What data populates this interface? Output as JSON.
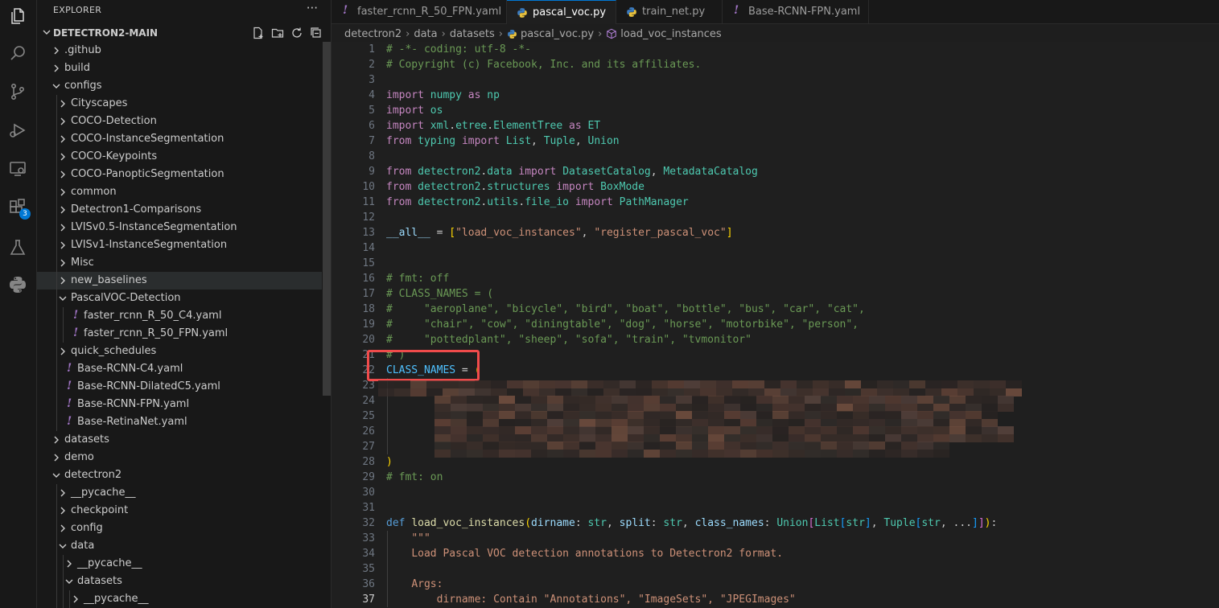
{
  "sidebar": {
    "title": "EXPLORER",
    "more": "···",
    "root": "DETECTRON2-MAIN",
    "rows": [
      {
        "label": ".github",
        "indent": 0,
        "kind": "folder",
        "open": false
      },
      {
        "label": "build",
        "indent": 0,
        "kind": "folder",
        "open": false
      },
      {
        "label": "configs",
        "indent": 0,
        "kind": "folder",
        "open": true
      },
      {
        "label": "Cityscapes",
        "indent": 1,
        "kind": "folder",
        "open": false
      },
      {
        "label": "COCO-Detection",
        "indent": 1,
        "kind": "folder",
        "open": false
      },
      {
        "label": "COCO-InstanceSegmentation",
        "indent": 1,
        "kind": "folder",
        "open": false
      },
      {
        "label": "COCO-Keypoints",
        "indent": 1,
        "kind": "folder",
        "open": false
      },
      {
        "label": "COCO-PanopticSegmentation",
        "indent": 1,
        "kind": "folder",
        "open": false
      },
      {
        "label": "common",
        "indent": 1,
        "kind": "folder",
        "open": false
      },
      {
        "label": "Detectron1-Comparisons",
        "indent": 1,
        "kind": "folder",
        "open": false
      },
      {
        "label": "LVISv0.5-InstanceSegmentation",
        "indent": 1,
        "kind": "folder",
        "open": false
      },
      {
        "label": "LVISv1-InstanceSegmentation",
        "indent": 1,
        "kind": "folder",
        "open": false
      },
      {
        "label": "Misc",
        "indent": 1,
        "kind": "folder",
        "open": false
      },
      {
        "label": "new_baselines",
        "indent": 1,
        "kind": "folder",
        "open": false,
        "selected": true
      },
      {
        "label": "PascalVOC-Detection",
        "indent": 1,
        "kind": "folder",
        "open": true
      },
      {
        "label": "faster_rcnn_R_50_C4.yaml",
        "indent": 2,
        "kind": "yaml"
      },
      {
        "label": "faster_rcnn_R_50_FPN.yaml",
        "indent": 2,
        "kind": "yaml"
      },
      {
        "label": "quick_schedules",
        "indent": 1,
        "kind": "folder",
        "open": false
      },
      {
        "label": "Base-RCNN-C4.yaml",
        "indent": 1,
        "kind": "yaml"
      },
      {
        "label": "Base-RCNN-DilatedC5.yaml",
        "indent": 1,
        "kind": "yaml"
      },
      {
        "label": "Base-RCNN-FPN.yaml",
        "indent": 1,
        "kind": "yaml"
      },
      {
        "label": "Base-RetinaNet.yaml",
        "indent": 1,
        "kind": "yaml"
      },
      {
        "label": "datasets",
        "indent": 0,
        "kind": "folder",
        "open": false
      },
      {
        "label": "demo",
        "indent": 0,
        "kind": "folder",
        "open": false
      },
      {
        "label": "detectron2",
        "indent": 0,
        "kind": "folder",
        "open": true
      },
      {
        "label": "__pycache__",
        "indent": 1,
        "kind": "folder",
        "open": false
      },
      {
        "label": "checkpoint",
        "indent": 1,
        "kind": "folder",
        "open": false
      },
      {
        "label": "config",
        "indent": 1,
        "kind": "folder",
        "open": false
      },
      {
        "label": "data",
        "indent": 1,
        "kind": "folder",
        "open": true
      },
      {
        "label": "__pycache__",
        "indent": 2,
        "kind": "folder",
        "open": false
      },
      {
        "label": "datasets",
        "indent": 2,
        "kind": "folder",
        "open": true
      },
      {
        "label": "__pycache__",
        "indent": 3,
        "kind": "folder",
        "open": false
      }
    ]
  },
  "activity": {
    "extensions_badge": "3",
    "icons": [
      "files-icon",
      "search-icon",
      "source-control-icon",
      "run-debug-icon",
      "remote-explorer-icon",
      "extensions-icon",
      "testing-icon",
      "python-icon"
    ]
  },
  "tabs": [
    {
      "label": "faster_rcnn_R_50_FPN.yaml",
      "kind": "yaml",
      "active": false
    },
    {
      "label": "pascal_voc.py",
      "kind": "python",
      "active": true
    },
    {
      "label": "train_net.py",
      "kind": "python",
      "active": false
    },
    {
      "label": "Base-RCNN-FPN.yaml",
      "kind": "yaml",
      "active": false
    }
  ],
  "breadcrumb": {
    "parts": [
      "detectron2",
      "data",
      "datasets"
    ],
    "file": "pascal_voc.py",
    "symbol": "load_voc_instances"
  },
  "editor": {
    "current_line": 37,
    "lines": [
      {
        "n": "1",
        "tokens": [
          [
            "c",
            "# -*- coding: utf-8 -*-"
          ]
        ]
      },
      {
        "n": "2",
        "tokens": [
          [
            "c",
            "# Copyright (c) Facebook, Inc. and its affiliates."
          ]
        ]
      },
      {
        "n": "3",
        "tokens": []
      },
      {
        "n": "4",
        "tokens": [
          [
            "kc",
            "import"
          ],
          [
            "",
            " "
          ],
          [
            "cls",
            "numpy"
          ],
          [
            "",
            " "
          ],
          [
            "kc",
            "as"
          ],
          [
            "",
            " "
          ],
          [
            "cls",
            "np"
          ]
        ]
      },
      {
        "n": "5",
        "tokens": [
          [
            "kc",
            "import"
          ],
          [
            "",
            " "
          ],
          [
            "cls",
            "os"
          ]
        ]
      },
      {
        "n": "6",
        "tokens": [
          [
            "kc",
            "import"
          ],
          [
            "",
            " "
          ],
          [
            "cls",
            "xml"
          ],
          [
            "",
            "."
          ],
          [
            "cls",
            "etree"
          ],
          [
            "",
            "."
          ],
          [
            "cls",
            "ElementTree"
          ],
          [
            "",
            " "
          ],
          [
            "kc",
            "as"
          ],
          [
            "",
            " "
          ],
          [
            "cls",
            "ET"
          ]
        ]
      },
      {
        "n": "7",
        "tokens": [
          [
            "kc",
            "from"
          ],
          [
            "",
            " "
          ],
          [
            "cls",
            "typing"
          ],
          [
            "",
            " "
          ],
          [
            "kc",
            "import"
          ],
          [
            "",
            " "
          ],
          [
            "cls",
            "List"
          ],
          [
            "",
            ", "
          ],
          [
            "cls",
            "Tuple"
          ],
          [
            "",
            ", "
          ],
          [
            "cls",
            "Union"
          ]
        ]
      },
      {
        "n": "8",
        "tokens": []
      },
      {
        "n": "9",
        "tokens": [
          [
            "kc",
            "from"
          ],
          [
            "",
            " "
          ],
          [
            "cls",
            "detectron2"
          ],
          [
            "",
            "."
          ],
          [
            "cls",
            "data"
          ],
          [
            "",
            " "
          ],
          [
            "kc",
            "import"
          ],
          [
            "",
            " "
          ],
          [
            "cls",
            "DatasetCatalog"
          ],
          [
            "",
            ", "
          ],
          [
            "cls",
            "MetadataCatalog"
          ]
        ]
      },
      {
        "n": "10",
        "tokens": [
          [
            "kc",
            "from"
          ],
          [
            "",
            " "
          ],
          [
            "cls",
            "detectron2"
          ],
          [
            "",
            "."
          ],
          [
            "cls",
            "structures"
          ],
          [
            "",
            " "
          ],
          [
            "kc",
            "import"
          ],
          [
            "",
            " "
          ],
          [
            "cls",
            "BoxMode"
          ]
        ]
      },
      {
        "n": "11",
        "tokens": [
          [
            "kc",
            "from"
          ],
          [
            "",
            " "
          ],
          [
            "cls",
            "detectron2"
          ],
          [
            "",
            "."
          ],
          [
            "cls",
            "utils"
          ],
          [
            "",
            "."
          ],
          [
            "cls",
            "file_io"
          ],
          [
            "",
            " "
          ],
          [
            "kc",
            "import"
          ],
          [
            "",
            " "
          ],
          [
            "cls",
            "PathManager"
          ]
        ]
      },
      {
        "n": "12",
        "tokens": []
      },
      {
        "n": "13",
        "tokens": [
          [
            "v",
            "__all__"
          ],
          [
            "",
            " = "
          ],
          [
            "br1",
            "["
          ],
          [
            "s",
            "\"load_voc_instances\""
          ],
          [
            "",
            ", "
          ],
          [
            "s",
            "\"register_pascal_voc\""
          ],
          [
            "br1",
            "]"
          ]
        ]
      },
      {
        "n": "14",
        "tokens": []
      },
      {
        "n": "15",
        "tokens": []
      },
      {
        "n": "16",
        "tokens": [
          [
            "c",
            "# fmt: off"
          ]
        ]
      },
      {
        "n": "17",
        "tokens": [
          [
            "c",
            "# CLASS_NAMES = ("
          ]
        ]
      },
      {
        "n": "18",
        "tokens": [
          [
            "c",
            "#     \"aeroplane\", \"bicycle\", \"bird\", \"boat\", \"bottle\", \"bus\", \"car\", \"cat\","
          ]
        ]
      },
      {
        "n": "19",
        "tokens": [
          [
            "c",
            "#     \"chair\", \"cow\", \"diningtable\", \"dog\", \"horse\", \"motorbike\", \"person\","
          ]
        ]
      },
      {
        "n": "20",
        "tokens": [
          [
            "c",
            "#     \"pottedplant\", \"sheep\", \"sofa\", \"train\", \"tvmonitor\""
          ]
        ]
      },
      {
        "n": "21",
        "tokens": [
          [
            "c",
            "# )"
          ]
        ]
      },
      {
        "n": "22",
        "tokens": [
          [
            "cn",
            "CLASS_NAMES"
          ],
          [
            "",
            " = "
          ],
          [
            "br1",
            "("
          ]
        ]
      },
      {
        "n": "23",
        "tokens": []
      },
      {
        "n": "24",
        "tokens": []
      },
      {
        "n": "25",
        "tokens": []
      },
      {
        "n": "26",
        "tokens": []
      },
      {
        "n": "27",
        "tokens": []
      },
      {
        "n": "28",
        "tokens": [
          [
            "br1",
            ")"
          ]
        ]
      },
      {
        "n": "29",
        "tokens": [
          [
            "c",
            "# fmt: on"
          ]
        ]
      },
      {
        "n": "30",
        "tokens": []
      },
      {
        "n": "31",
        "tokens": []
      },
      {
        "n": "32",
        "tokens": [
          [
            "k",
            "def"
          ],
          [
            "",
            " "
          ],
          [
            "f",
            "load_voc_instances"
          ],
          [
            "br1",
            "("
          ],
          [
            "v",
            "dirname"
          ],
          [
            "",
            ": "
          ],
          [
            "cls",
            "str"
          ],
          [
            "",
            ", "
          ],
          [
            "v",
            "split"
          ],
          [
            "",
            ": "
          ],
          [
            "cls",
            "str"
          ],
          [
            "",
            ", "
          ],
          [
            "v",
            "class_names"
          ],
          [
            "",
            ": "
          ],
          [
            "cls",
            "Union"
          ],
          [
            "br2",
            "["
          ],
          [
            "cls",
            "List"
          ],
          [
            "br3",
            "["
          ],
          [
            "cls",
            "str"
          ],
          [
            "br3",
            "]"
          ],
          [
            "",
            ", "
          ],
          [
            "cls",
            "Tuple"
          ],
          [
            "br3",
            "["
          ],
          [
            "cls",
            "str"
          ],
          [
            "",
            ", ..."
          ],
          [
            "br3",
            "]"
          ],
          [
            "br2",
            "]"
          ],
          [
            "br1",
            ")"
          ],
          [
            "",
            ":"
          ]
        ]
      },
      {
        "n": "33",
        "tokens": [
          [
            "",
            "    "
          ],
          [
            "s",
            "\"\"\""
          ]
        ]
      },
      {
        "n": "34",
        "tokens": [
          [
            "",
            "    "
          ],
          [
            "s",
            "Load Pascal VOC detection annotations to Detectron2 format."
          ]
        ]
      },
      {
        "n": "35",
        "tokens": []
      },
      {
        "n": "36",
        "tokens": [
          [
            "",
            "    "
          ],
          [
            "s",
            "Args:"
          ]
        ]
      },
      {
        "n": "37",
        "tokens": [
          [
            "",
            "        "
          ],
          [
            "s",
            "dirname: Contain \"Annotations\", \"ImageSets\", \"JPEGImages\""
          ]
        ]
      }
    ]
  }
}
